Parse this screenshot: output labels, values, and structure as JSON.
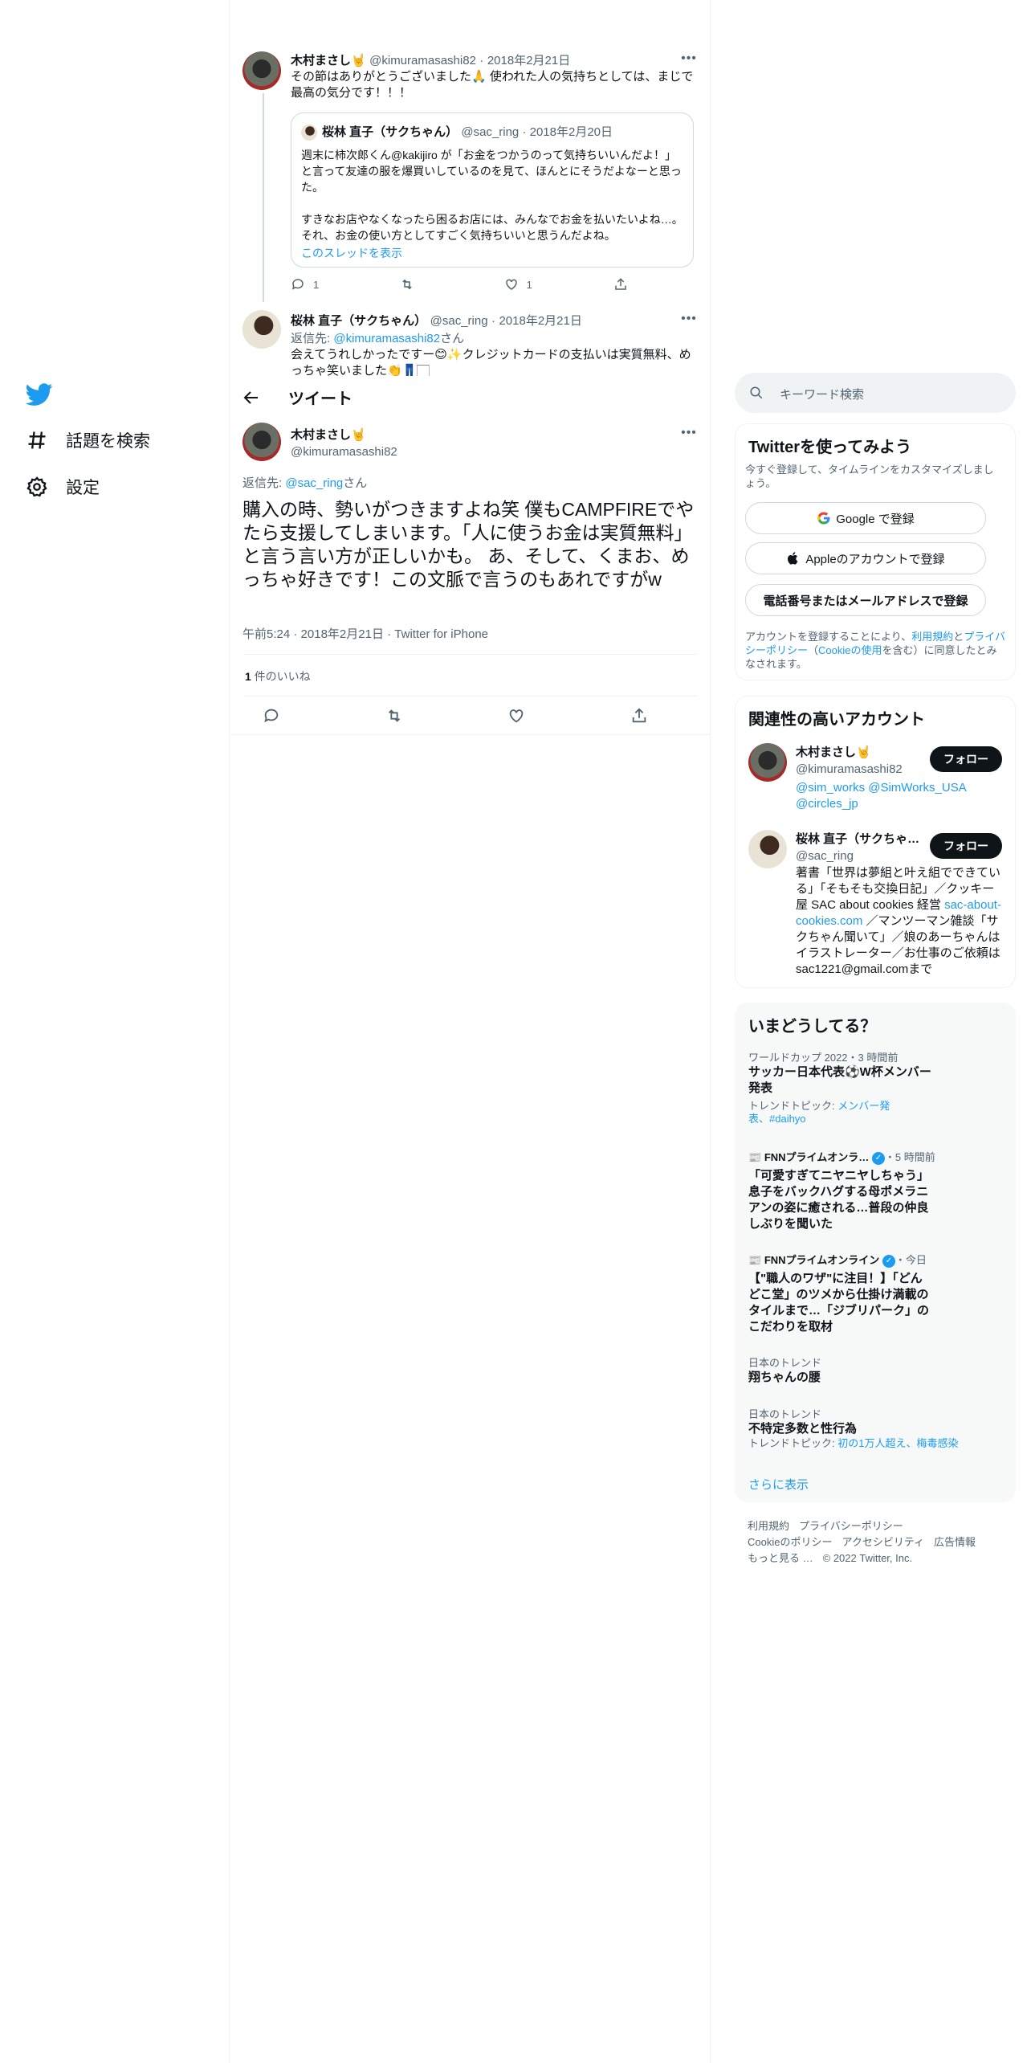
{
  "nav": {
    "items": [
      {
        "label": "話題を検索",
        "icon": "hashtag-icon"
      },
      {
        "label": "設定",
        "icon": "gear-icon"
      }
    ]
  },
  "thread": {
    "tweet1": {
      "name": "木村まさし🤘",
      "handle": "@kimuramasashi82",
      "date": "2018年2月21日",
      "text": "その節はありがとうございました🙏 使われた人の気持ちとしては、まじで最高の気分です！！！",
      "quote": {
        "name": "桜林 直子（サクちゃん）",
        "handle": "@sac_ring",
        "date": "2018年2月20日",
        "text1": "週末に柿次郎くん@kakijiro が「お金をつかうのって気持ちいいんだよ！」と言って友達の服を爆買いしているのを見て、ほんとにそうだよなーと思った。",
        "text2": "すきなお店やなくなったら困るお店には、みんなでお金を払いたいよね…。それ、お金の使い方としてすごく気持ちいいと思うんだよね。",
        "show_thread": "このスレッドを表示"
      },
      "reply_count": "1",
      "like_count": "1"
    },
    "tweet2": {
      "name": "桜林 直子（サクちゃん）",
      "handle": "@sac_ring",
      "date": "2018年2月21日",
      "reply_to_prefix": "返信先: ",
      "reply_to_handle": "@kimuramasashi82",
      "reply_to_suffix": "さん",
      "text": "会えてうれしかったですー😊✨クレジットカードの支払いは実質無料、めっちゃ笑いました👏👖🏻"
    }
  },
  "header": {
    "title": "ツイート"
  },
  "main_tweet": {
    "name": "木村まさし🤘",
    "handle": "@kimuramasashi82",
    "reply_to_prefix": "返信先: ",
    "reply_to_handle": "@sac_ring",
    "reply_to_suffix": "さん",
    "text": "購入の時、勢いがつきますよね笑 僕もCAMPFIREでやたら支援してしまいます。「人に使うお金は実質無料」と言う言い方が正しいかも。 あ、そして、くまお、めっちゃ好きです！この文脈で言うのもあれですがw",
    "time": "午前5:24",
    "date": "2018年2月21日",
    "source": "Twitter for iPhone",
    "likes_count": "1",
    "likes_label": " 件のいいね"
  },
  "sidebar": {
    "search_placeholder": "キーワード検索",
    "signup": {
      "title": "Twitterを使ってみよう",
      "subtitle": "今すぐ登録して、タイムラインをカスタマイズしましょう。",
      "google_label": "Google で登録",
      "apple_label": "Appleのアカウントで登録",
      "phone_label": "電話番号またはメールアドレスで登録",
      "legal_1": "アカウントを登録することにより、",
      "legal_terms": "利用規約",
      "legal_2": "と",
      "legal_privacy": "プライバシーポリシー",
      "legal_3": "（",
      "legal_cookie": "Cookieの使用",
      "legal_4": "を含む）に同意したとみなされます。"
    },
    "related": {
      "title": "関連性の高いアカウント",
      "follow_label": "フォロー",
      "accounts": [
        {
          "name": "木村まさし🤘",
          "handle": "@kimuramasashi82",
          "bio_links": "@sim_works @SimWorks_USA @circles_jp"
        },
        {
          "name": "桜林 直子（サクちゃ…",
          "handle": "@sac_ring",
          "bio_1": "著書「世界は夢組と叶え組でできている」「そもそも交換日記」／クッキー屋 SAC about cookies 経営 ",
          "bio_link": "sac-about-cookies.com",
          "bio_2": " ／マンツーマン雑談「サクちゃん聞いて」／娘のあーちゃんはイラストレーター／お仕事のご依頼は sac1221@gmail.comまで"
        }
      ]
    },
    "trends": {
      "title": "いまどうしてる？",
      "items": [
        {
          "meta": "ワールドカップ 2022・3 時間前",
          "title": "サッカー日本代表⚽W杯メンバー発表",
          "extra_prefix": "トレンドトピック: ",
          "extra_links": "メンバー発表、#daihyo"
        },
        {
          "meta_source": "FNNプライムオンラ…",
          "meta_time": "・5 時間前",
          "title": "「可愛すぎてニヤニヤしちゃう」息子をバックハグする母ポメラニアンの姿に癒される…普段の仲良しぶりを聞いた"
        },
        {
          "meta_source": "FNNプライムオンライン",
          "meta_time": "・今日",
          "title": "【\"職人のワザ\"に注目！】「どんどこ堂」のツメから仕掛け満載のタイルまで…「ジブリパーク」のこだわりを取材"
        },
        {
          "meta": "日本のトレンド",
          "title": "翔ちゃんの腰"
        },
        {
          "meta": "日本のトレンド",
          "title": "不特定多数と性行為",
          "extra_prefix": "トレンドトピック: ",
          "extra_links": "初の1万人超え、梅毒感染"
        }
      ],
      "show_more": "さらに表示"
    },
    "footer": {
      "links": [
        "利用規約",
        "プライバシーポリシー",
        "Cookieのポリシー",
        "アクセシビリティ",
        "広告情報",
        "もっと見る …"
      ],
      "copyright": "© 2022 Twitter, Inc."
    }
  }
}
